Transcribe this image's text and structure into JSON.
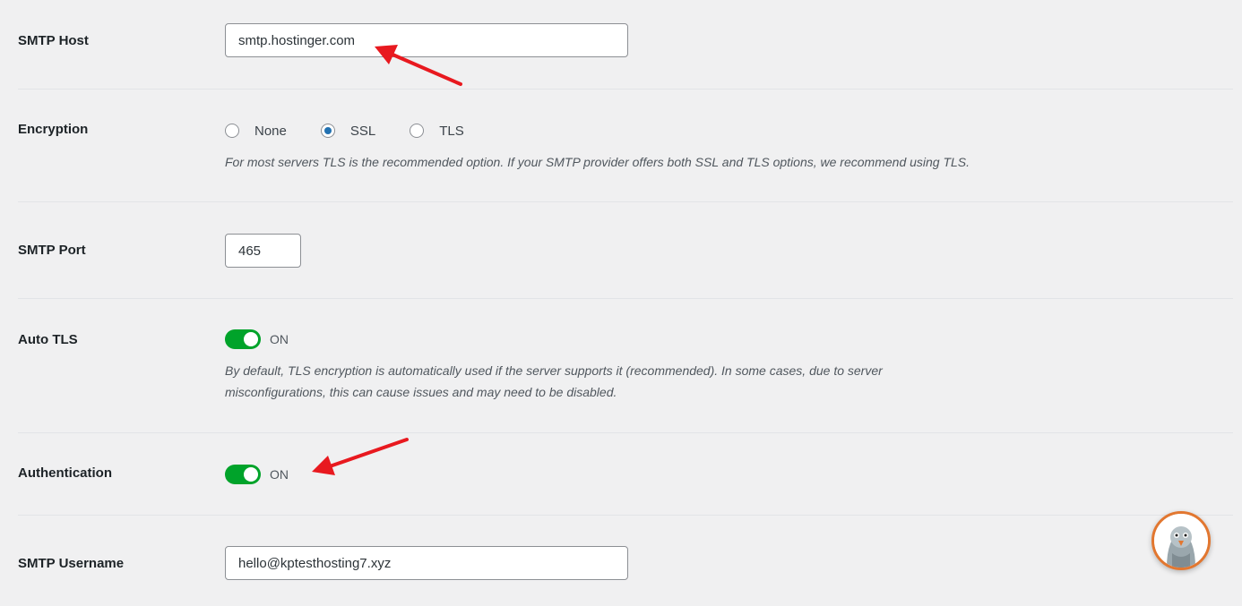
{
  "smtp_host": {
    "label": "SMTP Host",
    "value": "smtp.hostinger.com"
  },
  "encryption": {
    "label": "Encryption",
    "options": [
      {
        "label": "None",
        "checked": false
      },
      {
        "label": "SSL",
        "checked": true
      },
      {
        "label": "TLS",
        "checked": false
      }
    ],
    "help": "For most servers TLS is the recommended option. If your SMTP provider offers both SSL and TLS options, we recommend using TLS."
  },
  "smtp_port": {
    "label": "SMTP Port",
    "value": "465"
  },
  "auto_tls": {
    "label": "Auto TLS",
    "state": "ON",
    "help_line1": "By default, TLS encryption is automatically used if the server supports it (recommended). In some cases, due to server",
    "help_line2": "misconfigurations, this can cause issues and may need to be disabled."
  },
  "authentication": {
    "label": "Authentication",
    "state": "ON"
  },
  "smtp_username": {
    "label": "SMTP Username",
    "value": "hello@kptesthosting7.xyz"
  },
  "colors": {
    "accent": "#2271b1",
    "toggle_on": "#00a32a",
    "arrow": "#e8191f",
    "avatar_ring": "#e27730"
  },
  "icons": {
    "support_avatar": "pigeon-mascot-icon",
    "annotation_arrow": "red-arrow-icon"
  }
}
